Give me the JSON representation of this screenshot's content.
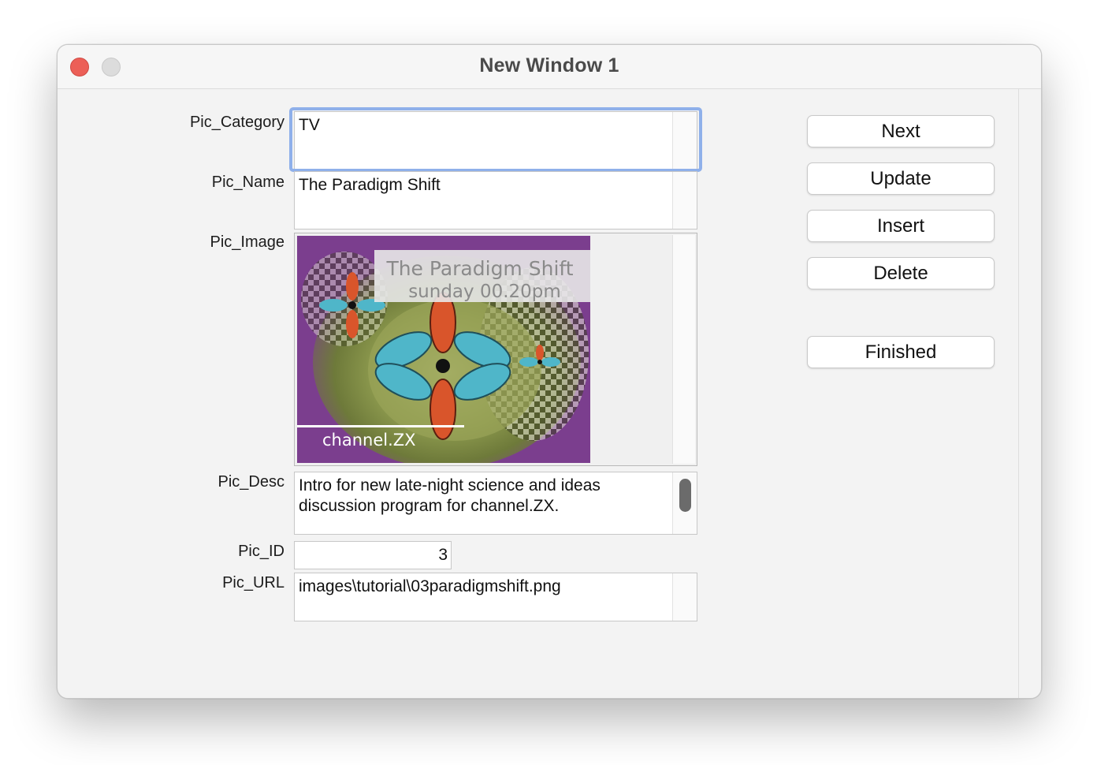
{
  "window": {
    "title": "New Window 1"
  },
  "fields": {
    "category": {
      "label": "Pic_Category",
      "value": "TV"
    },
    "name": {
      "label": "Pic_Name",
      "value": "The Paradigm Shift"
    },
    "image": {
      "label": "Pic_Image",
      "banner_line1": "The Paradigm Shift",
      "banner_line2": "sunday 00.20pm",
      "footer": "channel.ZX"
    },
    "desc": {
      "label": "Pic_Desc",
      "value": "Intro for new late-night science and ideas\ndiscussion program for channel.ZX."
    },
    "id": {
      "label": "Pic_ID",
      "value": "3"
    },
    "url": {
      "label": "Pic_URL",
      "value": "images\\tutorial\\03paradigmshift.png"
    }
  },
  "buttons": {
    "next": "Next",
    "update": "Update",
    "insert": "Insert",
    "delete": "Delete",
    "finished": "Finished"
  },
  "colors": {
    "focus_ring": "#8fb0ea",
    "close_button": "#ec5f57",
    "image_background": "#7b3e8e"
  }
}
